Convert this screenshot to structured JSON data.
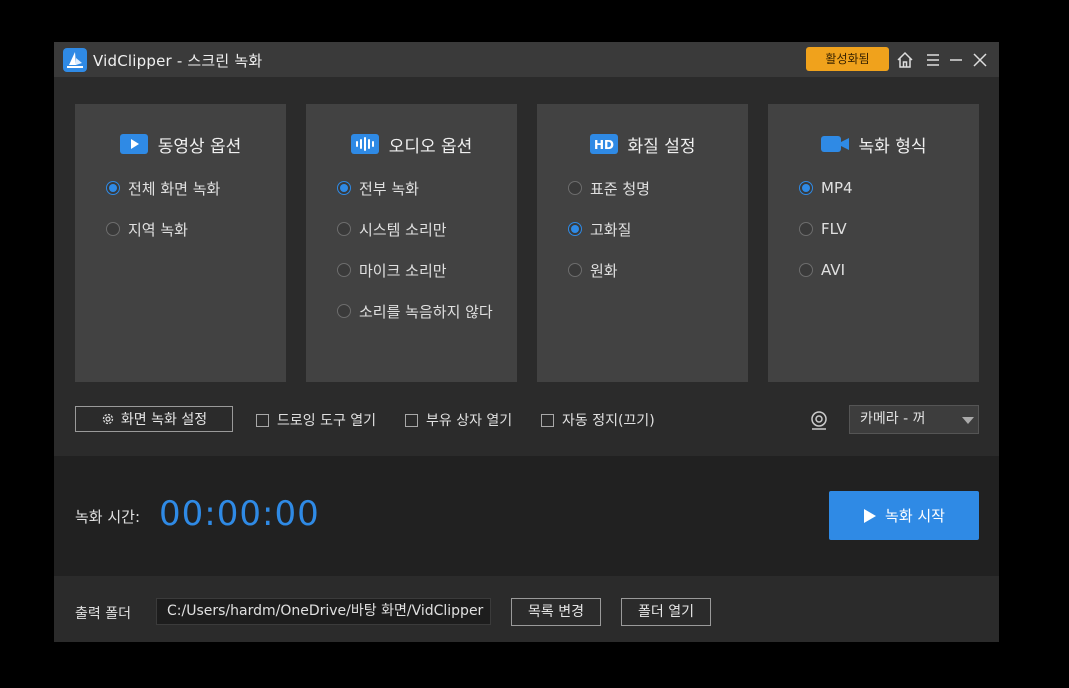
{
  "window": {
    "title": "VidClipper - 스크린 녹화",
    "activate_label": "활성화됨"
  },
  "panels": [
    {
      "title": "동영상 옵션",
      "icon": "video-play-icon",
      "options": [
        {
          "label": "전체 화면 녹화",
          "selected": true
        },
        {
          "label": "지역 녹화",
          "selected": false
        }
      ]
    },
    {
      "title": "오디오 옵션",
      "icon": "audio-wave-icon",
      "options": [
        {
          "label": "전부 녹화",
          "selected": true
        },
        {
          "label": "시스템 소리만",
          "selected": false
        },
        {
          "label": "마이크 소리만",
          "selected": false
        },
        {
          "label": "소리를 녹음하지 않다",
          "selected": false
        }
      ]
    },
    {
      "title": "화질 설정",
      "icon": "hd-icon",
      "icon_text": "HD",
      "options": [
        {
          "label": "표준 청명",
          "selected": false
        },
        {
          "label": "고화질",
          "selected": true
        },
        {
          "label": "원화",
          "selected": false
        }
      ]
    },
    {
      "title": "녹화 형식",
      "icon": "camera-icon",
      "options": [
        {
          "label": "MP4",
          "selected": true
        },
        {
          "label": "FLV",
          "selected": false
        },
        {
          "label": "AVI",
          "selected": false
        }
      ]
    }
  ],
  "toolbar": {
    "settings_label": "화면 녹화 설정",
    "checkboxes": [
      {
        "label": "드로잉 도구 열기",
        "checked": false
      },
      {
        "label": "부유 상자 열기",
        "checked": false
      },
      {
        "label": "자동 정지(끄기)",
        "checked": false
      }
    ],
    "camera_select": "카메라 - 꺼"
  },
  "record": {
    "time_label": "녹화 시간:",
    "time_value": "00:00:00",
    "start_label": "녹화 시작"
  },
  "output": {
    "label": "출력 폴더",
    "path": "C:/Users/hardm/OneDrive/바탕 화면/VidClipper",
    "change_label": "목록 변경",
    "open_label": "폴더 열기"
  },
  "colors": {
    "accent": "#2f8ae5",
    "activate": "#f0a21c",
    "panel": "#424242",
    "background": "#2b2b2b"
  }
}
